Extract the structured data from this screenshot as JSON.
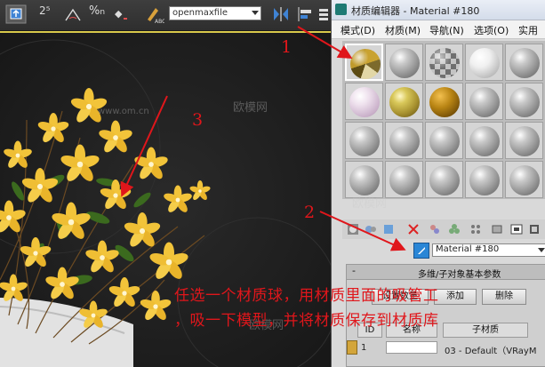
{
  "toolbar": {
    "snap_2_5": "2⁵",
    "dropdown_value": "openmaxfile"
  },
  "material_editor": {
    "title": "材质编辑器 - Material #180",
    "menu": [
      "模式(D)",
      "材质(M)",
      "导航(N)",
      "选项(O)",
      "实用"
    ],
    "current_material": "Material #180",
    "rollout_title": "多维/子对象基本参数",
    "set_number_label": "设置数量",
    "add_label": "添加",
    "delete_label": "删除",
    "col_id": "ID",
    "col_name": "名称",
    "col_sub": "子材质",
    "row1_id": "1",
    "row1_sub": "03 - Default（VRayM"
  },
  "annotations": {
    "num1": "1",
    "num2": "2",
    "num3": "3",
    "caption_line1": "任选一个材质球，用材质里面的吸管工",
    "caption_line2": "，吸一下模型，并将材质保存到材质库"
  },
  "watermarks": [
    "欧模网",
    "欧模网",
    "欧模网",
    "www.om.cn"
  ],
  "colors": {
    "annotation_red": "#e0161b",
    "viewport_bg": "#1e1e1e",
    "flower_yellow": "#f2c43a"
  }
}
